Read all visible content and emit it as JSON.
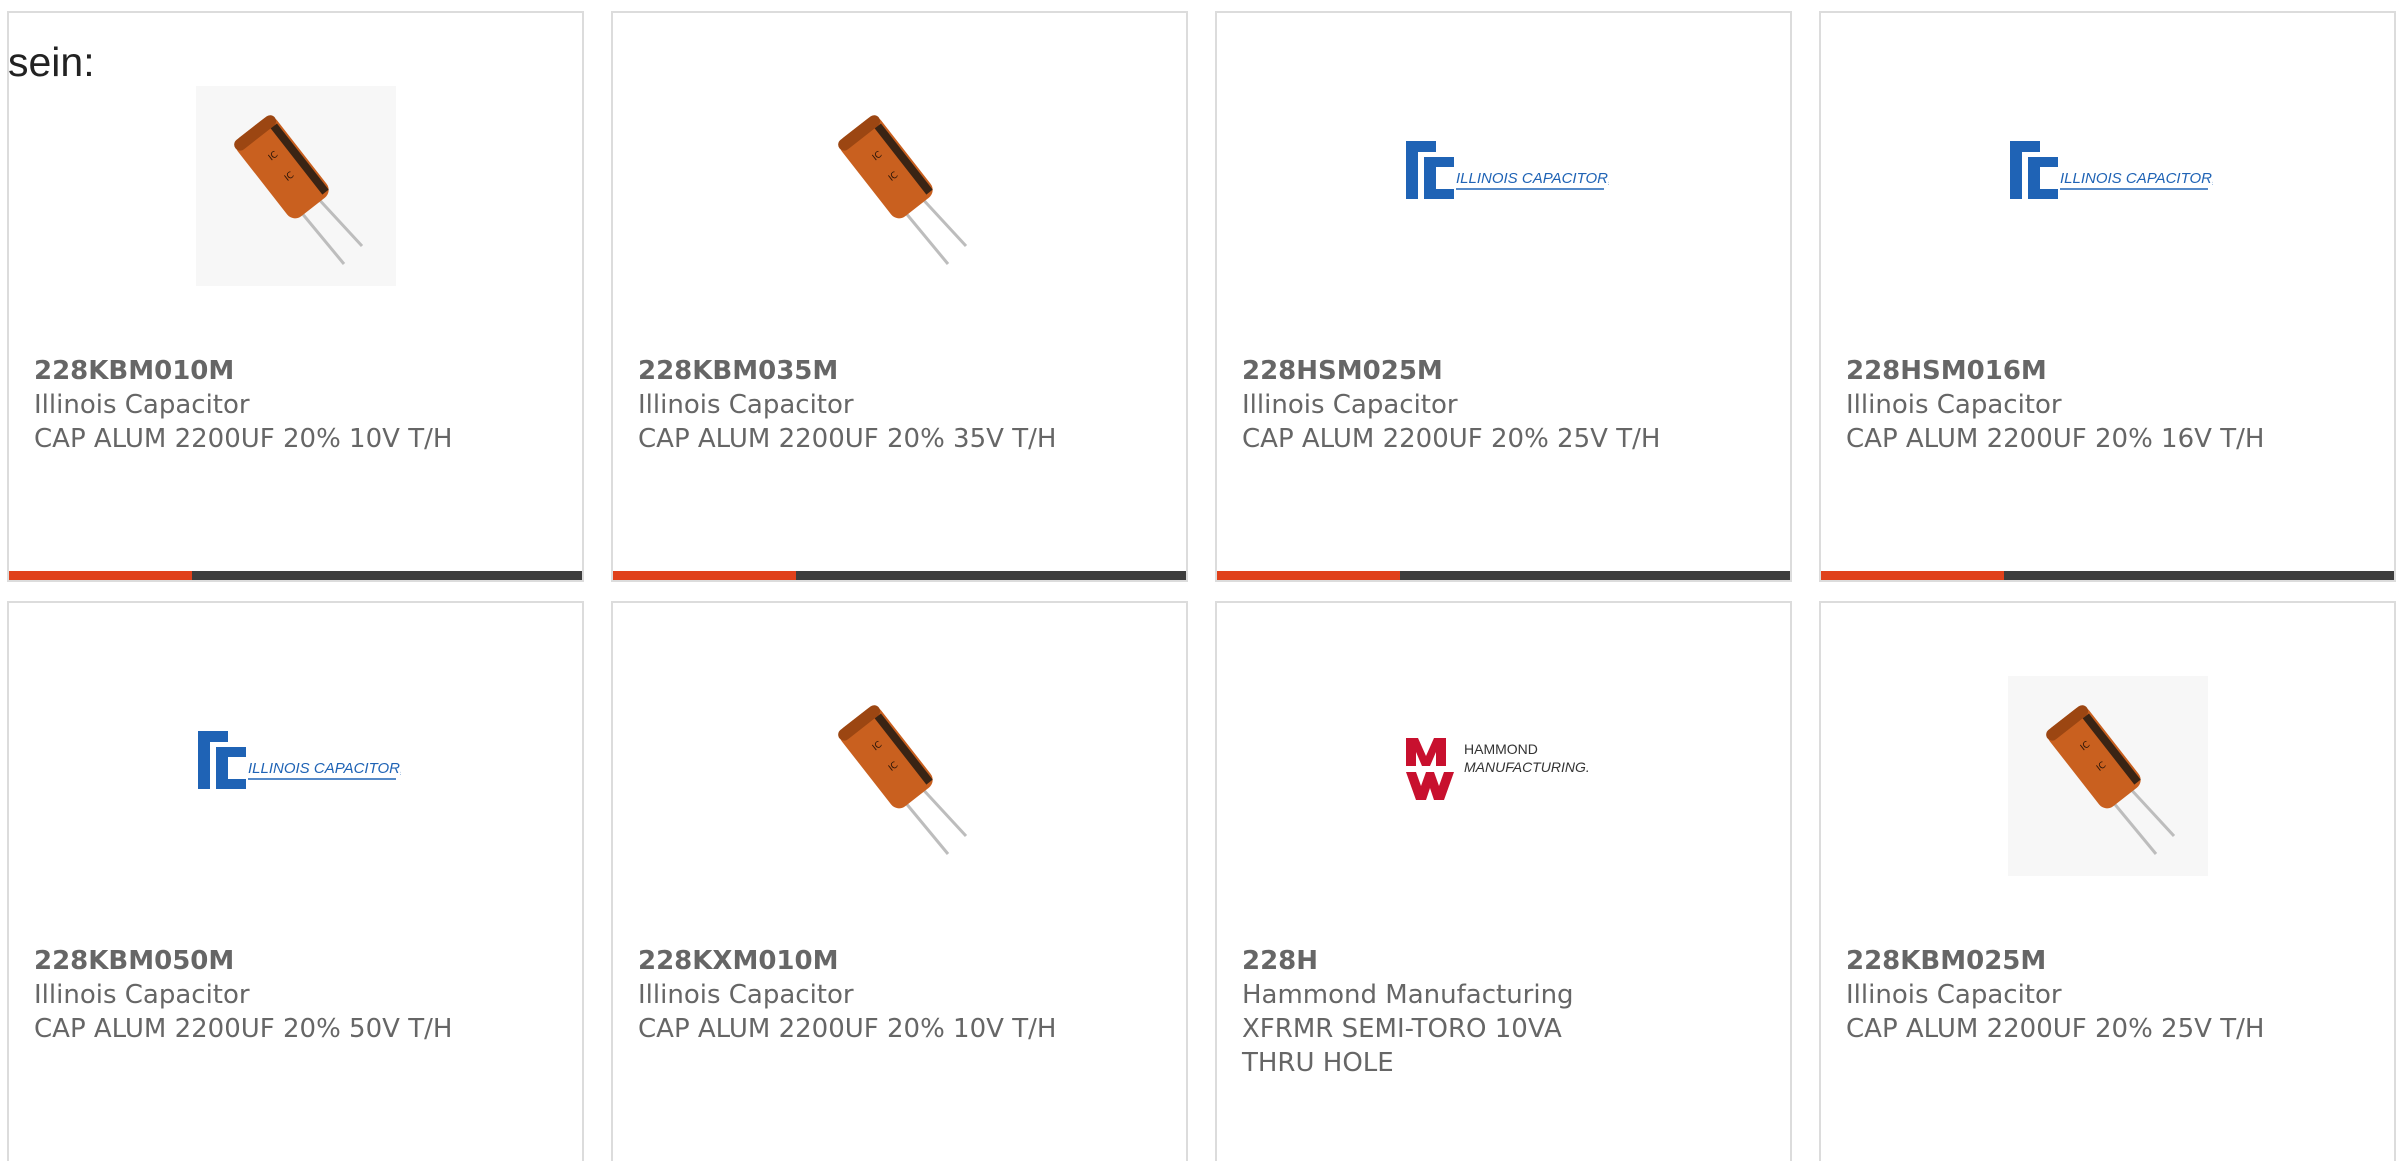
{
  "intro_text": "sein:",
  "colors": {
    "accent": "#e0411b",
    "bar_dark": "#3d3d3d",
    "card_border": "#dcdcdc",
    "text": "#666666",
    "ic_blue": "#1f63b5",
    "hammond_red": "#c8102e"
  },
  "products": [
    {
      "part_number": "228KBM010M",
      "manufacturer": "Illinois Capacitor",
      "description": "CAP ALUM 2200UF 20% 10V T/H",
      "image": "capacitor-photo"
    },
    {
      "part_number": "228KBM035M",
      "manufacturer": "Illinois Capacitor",
      "description": "CAP ALUM 2200UF 20% 35V T/H",
      "image": "capacitor-photo"
    },
    {
      "part_number": "228HSM025M",
      "manufacturer": "Illinois Capacitor",
      "description": "CAP ALUM 2200UF 20% 25V T/H",
      "image": "illinois-capacitor-logo",
      "logo_text": "ILLINOIS CAPACITOR, INC."
    },
    {
      "part_number": "228HSM016M",
      "manufacturer": "Illinois Capacitor",
      "description": "CAP ALUM 2200UF 20% 16V T/H",
      "image": "illinois-capacitor-logo",
      "logo_text": "ILLINOIS CAPACITOR, INC."
    },
    {
      "part_number": "228KBM050M",
      "manufacturer": "Illinois Capacitor",
      "description": "CAP ALUM 2200UF 20% 50V T/H",
      "image": "illinois-capacitor-logo",
      "logo_text": "ILLINOIS CAPACITOR, INC."
    },
    {
      "part_number": "228KXM010M",
      "manufacturer": "Illinois Capacitor",
      "description": "CAP ALUM 2200UF 20% 10V T/H",
      "image": "capacitor-photo"
    },
    {
      "part_number": "228H",
      "manufacturer": "Hammond Manufacturing",
      "description": "XFRMR SEMI-TORO 10VA THRU HOLE",
      "image": "hammond-manufacturing-logo",
      "logo_text_line1": "HAMMOND",
      "logo_text_line2": "MANUFACTURING."
    },
    {
      "part_number": "228KBM025M",
      "manufacturer": "Illinois Capacitor",
      "description": "CAP ALUM 2200UF 20% 25V T/H",
      "image": "capacitor-photo"
    }
  ]
}
